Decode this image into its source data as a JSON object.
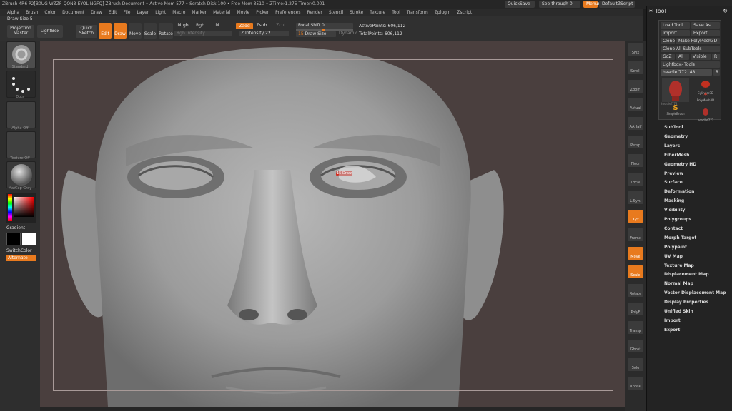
{
  "titlebar": {
    "text": "ZBrush 4R6 P2[B0UG-WZZF-QON3-EYOL-NGFQ]   ZBrush Document   • Active Mem 577 • Scratch Disk 100 • Free Mem 3510 • ZTime›1.275 Timer›0.001",
    "quicksave": "QuickSave",
    "seethrough": "See-through 0",
    "menus": "Menus",
    "defaultzscript": "DefaultZScript"
  },
  "menubar": [
    "Alpha",
    "Brush",
    "Color",
    "Document",
    "Draw",
    "Edit",
    "File",
    "Layer",
    "Light",
    "Macro",
    "Marker",
    "Material",
    "Movie",
    "Picker",
    "Preferences",
    "Render",
    "Stencil",
    "Stroke",
    "Texture",
    "Tool",
    "Transform",
    "Zplugin",
    "Zscript"
  ],
  "shelf": {
    "draw_size_label": "Draw Size",
    "draw_size_value": "5",
    "projection_master": "Projection Master",
    "lightbox": "LightBox",
    "quick_sketch": "Quick Sketch",
    "edit": "Edit",
    "draw": "Draw",
    "move": "Move",
    "scale": "Scale",
    "rotate": "Rotate",
    "mrgb": "Mrgb",
    "rgb": "Rgb",
    "m": "M",
    "rgb_intensity": "Rgb Intensity",
    "zadd": "Zadd",
    "zsub": "Zsub",
    "zcut": "Zcut",
    "z_intensity": "Z Intensity 22",
    "focal_shift": "Focal Shift 0",
    "draw_size": "Draw Size",
    "draw_size_num": "15",
    "dynamic": "Dynamic",
    "active_points": "ActivePoints: 606,112",
    "total_points": "TotalPoints: 606,112"
  },
  "left": {
    "brush_label": "Standard",
    "stroke_label": "Dots",
    "alpha_label": "Alpha Off",
    "texture_label": "Texture Off",
    "material_label": "MatCap Gray",
    "gradient": "Gradient",
    "switchcolor": "SwitchColor",
    "alternate": "Alternate"
  },
  "canvas": {
    "cursor_label": "15 Draw"
  },
  "rstrip": [
    "SPix",
    "Scroll",
    "Zoom",
    "Actual",
    "AAHalf",
    "Persp",
    "Floor",
    "Local",
    "L.Sym",
    "Xyz",
    "Frame",
    "Move",
    "Scale",
    "Rotate",
    "PolyF",
    "Transp",
    "Ghost",
    "Solo",
    "Xpose"
  ],
  "tool": {
    "title": "Tool",
    "load_tool": "Load Tool",
    "save_as": "Save As",
    "import": "Import",
    "export": "Export",
    "clone": "Clone",
    "make_polymesh": "Make PolyMesh3D",
    "clone_all": "Clone All SubTools",
    "goz": "GoZ",
    "all": "All",
    "visible": "Visible",
    "r": "R",
    "lightbox_tools": "Lightbox› Tools",
    "current_tool": "headlef772. 48",
    "thumbs": [
      "headlef772",
      "Cylinder3D",
      "PolyMesh3D",
      "SimpleBrush",
      "headlef772"
    ],
    "items": [
      "SubTool",
      "Geometry",
      "Layers",
      "FiberMesh",
      "Geometry HD",
      "Preview",
      "Surface",
      "Deformation",
      "Masking",
      "Visibility",
      "Polygroups",
      "Contact",
      "Morph Target",
      "Polypaint",
      "UV Map",
      "Texture Map",
      "Displacement Map",
      "Normal Map",
      "Vector Displacement Map",
      "Display Properties",
      "Unified Skin",
      "Import",
      "Export"
    ]
  }
}
